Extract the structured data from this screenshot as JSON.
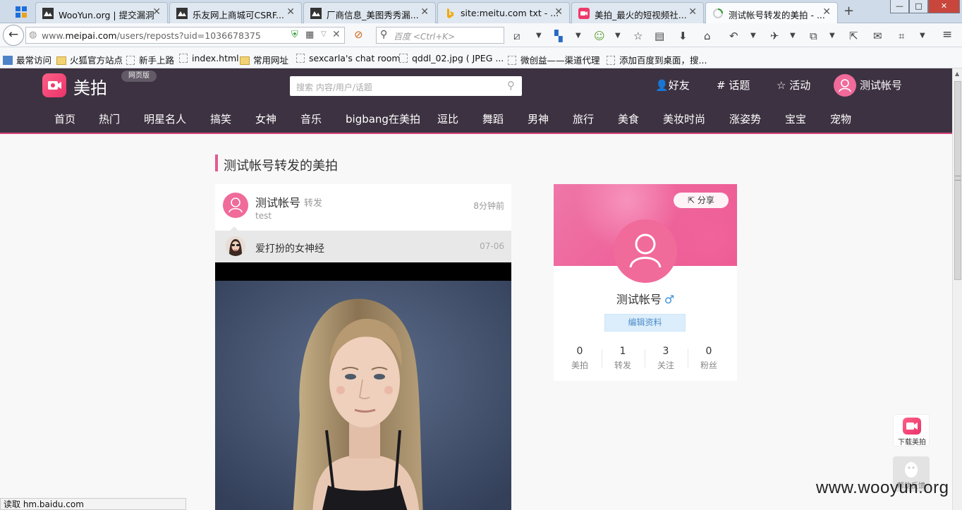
{
  "browser": {
    "tabs": [
      {
        "title": "WooYun.org | 提交漏洞"
      },
      {
        "title": "乐友网上商城可CSRF..."
      },
      {
        "title": "厂商信息_美图秀秀漏..."
      },
      {
        "title": "site:meitu.com txt - ..."
      },
      {
        "title": "美拍_最火的短视频社..."
      },
      {
        "title": "测试帐号转发的美拍 - ..."
      }
    ],
    "close_glyph": "✕",
    "new_tab_glyph": "+",
    "window_controls": {
      "minimize": "—",
      "maximize": "□",
      "close": "✕"
    },
    "url_prefix": "www.",
    "url_domain": "meipai.com",
    "url_path": "/users/reposts?uid=1036678375",
    "search_placeholder": "百度 <Ctrl+K>",
    "bookmarks": [
      "最常访问",
      "火狐官方站点",
      "新手上路",
      "index.html",
      "常用网址",
      "sexcarla's chat room",
      "qddl_02.jpg ( JPEG ...",
      "微创益——渠道代理",
      "添加百度到桌面，搜..."
    ],
    "status_text": "读取 hm.baidu.com"
  },
  "site": {
    "logo_text": "美拍",
    "web_badge": "网页版",
    "search_placeholder": "搜索 内容/用户/话题",
    "header_nav": [
      "好友",
      "话题",
      "活动",
      "测试帐号"
    ],
    "categories": [
      "首页",
      "热门",
      "明星名人",
      "搞笑",
      "女神",
      "音乐",
      "bigbang在美拍",
      "逗比",
      "舞蹈",
      "男神",
      "旅行",
      "美食",
      "美妆时尚",
      "涨姿势",
      "宝宝",
      "宠物"
    ]
  },
  "page": {
    "title": "测试帐号转发的美拍"
  },
  "feed": {
    "user": "测试帐号",
    "action": "转发",
    "comment": "test",
    "time": "8分钟前",
    "original_title": "爱打扮的女神经",
    "original_date": "07-06"
  },
  "profile": {
    "share_label": "分享",
    "name": "测试帐号",
    "gender_symbol": "♂",
    "edit_label": "编辑资料",
    "stats": [
      {
        "value": "0",
        "label": "美拍"
      },
      {
        "value": "1",
        "label": "转发"
      },
      {
        "value": "3",
        "label": "关注"
      },
      {
        "value": "0",
        "label": "粉丝"
      }
    ]
  },
  "float": {
    "download_label": "下载美拍",
    "help_label": "帮助反馈"
  },
  "watermark": "www.wooyun.org",
  "colors": {
    "header_bg": "#3d3241",
    "accent_pink": "#e35b91",
    "avatar_pink": "#f06a9a"
  }
}
